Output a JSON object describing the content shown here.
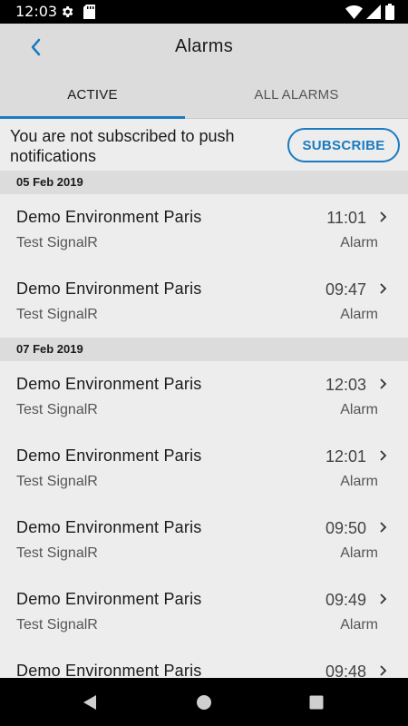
{
  "status_bar": {
    "time": "12:03",
    "icons": [
      "gear-icon",
      "sd-card-icon",
      "wifi-icon",
      "signal-icon",
      "battery-icon"
    ]
  },
  "app_bar": {
    "title": "Alarms",
    "back_icon": "chevron-left-icon"
  },
  "tabs": [
    {
      "label": "ACTIVE",
      "selected": true
    },
    {
      "label": "ALL ALARMS",
      "selected": false
    }
  ],
  "banner": {
    "message": "You are not subscribed to push notifications",
    "button_label": "SUBSCRIBE"
  },
  "groups": [
    {
      "date": "05 Feb 2019",
      "items": [
        {
          "name": "Demo Environment Paris",
          "subtitle": "Test SignalR",
          "time": "11:01",
          "type": "Alarm"
        },
        {
          "name": "Demo Environment Paris",
          "subtitle": "Test SignalR",
          "time": "09:47",
          "type": "Alarm"
        }
      ]
    },
    {
      "date": "07 Feb 2019",
      "items": [
        {
          "name": "Demo Environment Paris",
          "subtitle": "Test SignalR",
          "time": "12:03",
          "type": "Alarm"
        },
        {
          "name": "Demo Environment Paris",
          "subtitle": "Test SignalR",
          "time": "12:01",
          "type": "Alarm"
        },
        {
          "name": "Demo Environment Paris",
          "subtitle": "Test SignalR",
          "time": "09:50",
          "type": "Alarm"
        },
        {
          "name": "Demo Environment Paris",
          "subtitle": "Test SignalR",
          "time": "09:49",
          "type": "Alarm"
        },
        {
          "name": "Demo Environment Paris",
          "subtitle": "",
          "time": "09:48",
          "type": ""
        }
      ]
    }
  ],
  "colors": {
    "accent": "#1a7bc0",
    "header_bg": "#dcdcdc",
    "list_bg": "#ededed"
  },
  "nav_bar": {
    "icons": [
      "back-triangle-icon",
      "home-circle-icon",
      "recents-square-icon"
    ]
  }
}
